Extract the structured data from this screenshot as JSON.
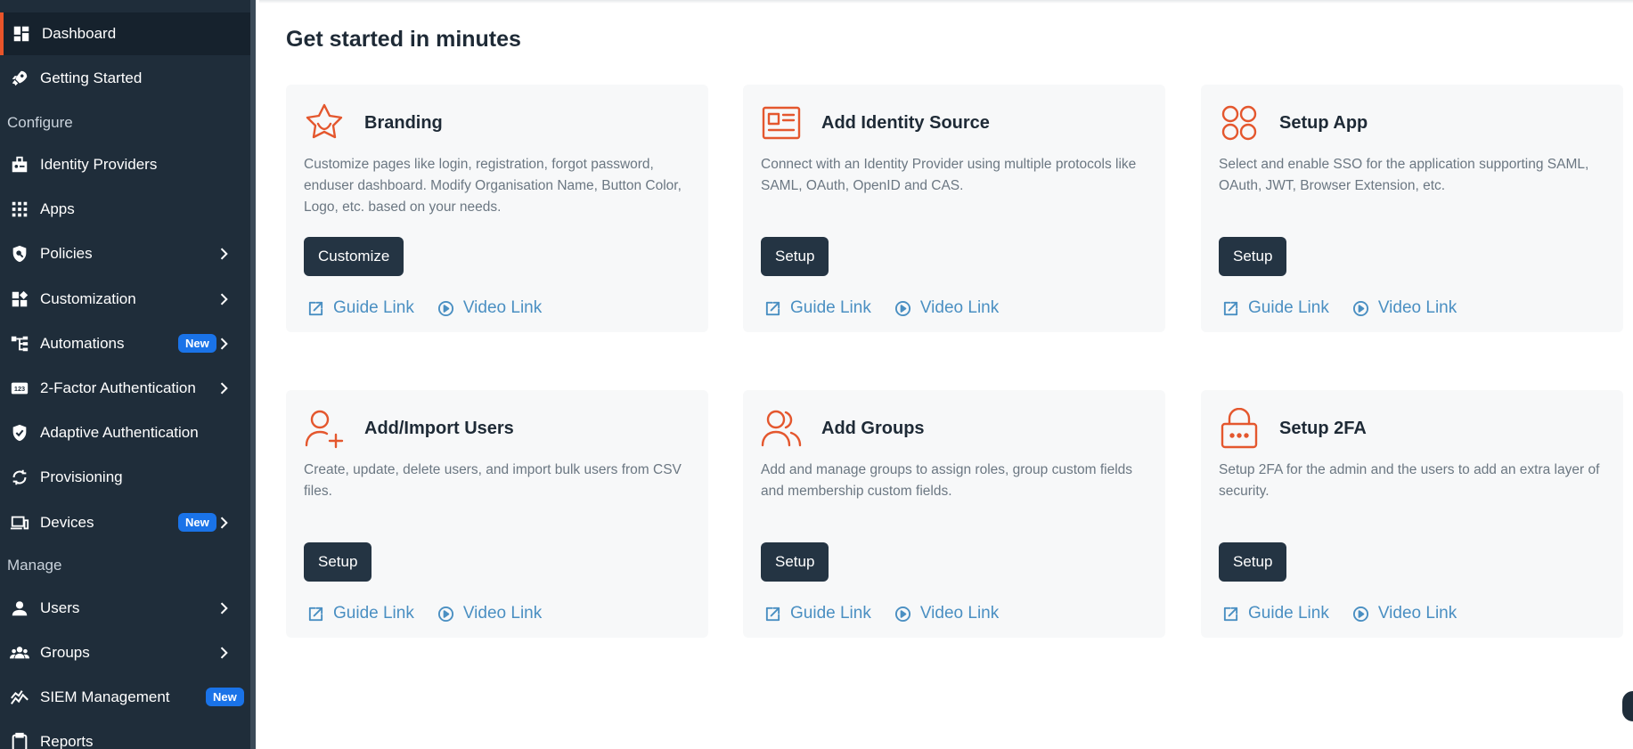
{
  "sidebar": {
    "items": [
      {
        "label": "Dashboard",
        "icon": "dashboard-icon",
        "active": true
      },
      {
        "label": "Getting Started",
        "icon": "rocket-icon"
      },
      {
        "label": "Identity Providers",
        "icon": "id-badge-icon"
      },
      {
        "label": "Apps",
        "icon": "grid-icon"
      },
      {
        "label": "Policies",
        "icon": "shield-search-icon",
        "chevron": true
      },
      {
        "label": "Customization",
        "icon": "widgets-icon",
        "chevron": true
      },
      {
        "label": "Automations",
        "icon": "workflow-icon",
        "chevron": true,
        "badge": "New"
      },
      {
        "label": "2-Factor Authentication",
        "icon": "number-123-icon",
        "chevron": true
      },
      {
        "label": "Adaptive Authentication",
        "icon": "shield-check-icon"
      },
      {
        "label": "Provisioning",
        "icon": "sync-icon"
      },
      {
        "label": "Devices",
        "icon": "devices-icon",
        "chevron": true,
        "badge": "New"
      },
      {
        "label": "Users",
        "icon": "user-icon",
        "chevron": true
      },
      {
        "label": "Groups",
        "icon": "group-icon",
        "chevron": true
      },
      {
        "label": "SIEM Management",
        "icon": "chart-line-icon",
        "badge": "New"
      },
      {
        "label": "Reports",
        "icon": "clipboard-icon"
      }
    ],
    "sections": {
      "configure": "Configure",
      "manage": "Manage"
    }
  },
  "main": {
    "title": "Get started in minutes",
    "cards": [
      {
        "title": "Branding",
        "icon": "star-badge-icon",
        "description": "Customize pages like login, registration, forgot password, enduser dashboard. Modify Organisation Name, Button Color, Logo, etc. based on your needs.",
        "button": "Customize",
        "guide": "Guide Link",
        "video": "Video Link"
      },
      {
        "title": "Add Identity Source",
        "icon": "id-card-icon",
        "description": "Connect with an Identity Provider using multiple protocols like SAML, OAuth, OpenID and CAS.",
        "button": "Setup",
        "guide": "Guide Link",
        "video": "Video Link"
      },
      {
        "title": "Setup App",
        "icon": "apps-icon",
        "description": "Select and enable SSO for the application supporting SAML, OAuth, JWT, Browser Extension, etc.",
        "button": "Setup",
        "guide": "Guide Link",
        "video": "Video Link"
      },
      {
        "title": "Add/Import Users",
        "icon": "user-plus-icon",
        "description": "Create, update, delete users, and import bulk users from CSV files.",
        "button": "Setup",
        "guide": "Guide Link",
        "video": "Video Link"
      },
      {
        "title": "Add Groups",
        "icon": "users-icon",
        "description": "Add and manage groups to assign roles, group custom fields and membership custom fields.",
        "button": "Setup",
        "guide": "Guide Link",
        "video": "Video Link"
      },
      {
        "title": "Setup 2FA",
        "icon": "lock-icon",
        "description": "Setup 2FA for the admin and the users to add an extra layer of security.",
        "button": "Setup",
        "guide": "Guide Link",
        "video": "Video Link"
      }
    ]
  },
  "colors": {
    "sidebar_bg": "#1f2d3a",
    "accent": "#e4572e",
    "button_bg": "#243443",
    "link": "#4a8fc2",
    "badge": "#1a73e8"
  }
}
